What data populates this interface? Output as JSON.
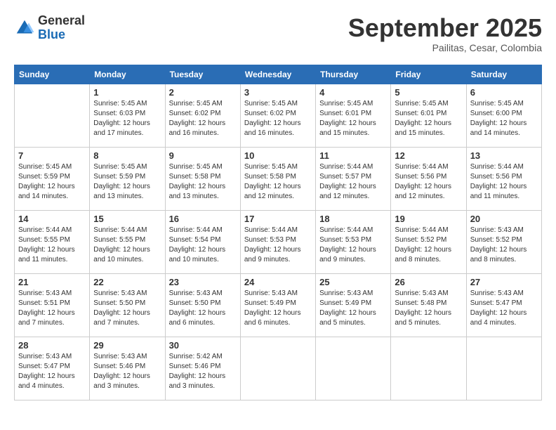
{
  "header": {
    "logo_general": "General",
    "logo_blue": "Blue",
    "month_title": "September 2025",
    "subtitle": "Pailitas, Cesar, Colombia"
  },
  "weekdays": [
    "Sunday",
    "Monday",
    "Tuesday",
    "Wednesday",
    "Thursday",
    "Friday",
    "Saturday"
  ],
  "weeks": [
    [
      {
        "day": "",
        "info": ""
      },
      {
        "day": "1",
        "info": "Sunrise: 5:45 AM\nSunset: 6:03 PM\nDaylight: 12 hours\nand 17 minutes."
      },
      {
        "day": "2",
        "info": "Sunrise: 5:45 AM\nSunset: 6:02 PM\nDaylight: 12 hours\nand 16 minutes."
      },
      {
        "day": "3",
        "info": "Sunrise: 5:45 AM\nSunset: 6:02 PM\nDaylight: 12 hours\nand 16 minutes."
      },
      {
        "day": "4",
        "info": "Sunrise: 5:45 AM\nSunset: 6:01 PM\nDaylight: 12 hours\nand 15 minutes."
      },
      {
        "day": "5",
        "info": "Sunrise: 5:45 AM\nSunset: 6:01 PM\nDaylight: 12 hours\nand 15 minutes."
      },
      {
        "day": "6",
        "info": "Sunrise: 5:45 AM\nSunset: 6:00 PM\nDaylight: 12 hours\nand 14 minutes."
      }
    ],
    [
      {
        "day": "7",
        "info": "Sunrise: 5:45 AM\nSunset: 5:59 PM\nDaylight: 12 hours\nand 14 minutes."
      },
      {
        "day": "8",
        "info": "Sunrise: 5:45 AM\nSunset: 5:59 PM\nDaylight: 12 hours\nand 13 minutes."
      },
      {
        "day": "9",
        "info": "Sunrise: 5:45 AM\nSunset: 5:58 PM\nDaylight: 12 hours\nand 13 minutes."
      },
      {
        "day": "10",
        "info": "Sunrise: 5:45 AM\nSunset: 5:58 PM\nDaylight: 12 hours\nand 12 minutes."
      },
      {
        "day": "11",
        "info": "Sunrise: 5:44 AM\nSunset: 5:57 PM\nDaylight: 12 hours\nand 12 minutes."
      },
      {
        "day": "12",
        "info": "Sunrise: 5:44 AM\nSunset: 5:56 PM\nDaylight: 12 hours\nand 12 minutes."
      },
      {
        "day": "13",
        "info": "Sunrise: 5:44 AM\nSunset: 5:56 PM\nDaylight: 12 hours\nand 11 minutes."
      }
    ],
    [
      {
        "day": "14",
        "info": "Sunrise: 5:44 AM\nSunset: 5:55 PM\nDaylight: 12 hours\nand 11 minutes."
      },
      {
        "day": "15",
        "info": "Sunrise: 5:44 AM\nSunset: 5:55 PM\nDaylight: 12 hours\nand 10 minutes."
      },
      {
        "day": "16",
        "info": "Sunrise: 5:44 AM\nSunset: 5:54 PM\nDaylight: 12 hours\nand 10 minutes."
      },
      {
        "day": "17",
        "info": "Sunrise: 5:44 AM\nSunset: 5:53 PM\nDaylight: 12 hours\nand 9 minutes."
      },
      {
        "day": "18",
        "info": "Sunrise: 5:44 AM\nSunset: 5:53 PM\nDaylight: 12 hours\nand 9 minutes."
      },
      {
        "day": "19",
        "info": "Sunrise: 5:44 AM\nSunset: 5:52 PM\nDaylight: 12 hours\nand 8 minutes."
      },
      {
        "day": "20",
        "info": "Sunrise: 5:43 AM\nSunset: 5:52 PM\nDaylight: 12 hours\nand 8 minutes."
      }
    ],
    [
      {
        "day": "21",
        "info": "Sunrise: 5:43 AM\nSunset: 5:51 PM\nDaylight: 12 hours\nand 7 minutes."
      },
      {
        "day": "22",
        "info": "Sunrise: 5:43 AM\nSunset: 5:50 PM\nDaylight: 12 hours\nand 7 minutes."
      },
      {
        "day": "23",
        "info": "Sunrise: 5:43 AM\nSunset: 5:50 PM\nDaylight: 12 hours\nand 6 minutes."
      },
      {
        "day": "24",
        "info": "Sunrise: 5:43 AM\nSunset: 5:49 PM\nDaylight: 12 hours\nand 6 minutes."
      },
      {
        "day": "25",
        "info": "Sunrise: 5:43 AM\nSunset: 5:49 PM\nDaylight: 12 hours\nand 5 minutes."
      },
      {
        "day": "26",
        "info": "Sunrise: 5:43 AM\nSunset: 5:48 PM\nDaylight: 12 hours\nand 5 minutes."
      },
      {
        "day": "27",
        "info": "Sunrise: 5:43 AM\nSunset: 5:47 PM\nDaylight: 12 hours\nand 4 minutes."
      }
    ],
    [
      {
        "day": "28",
        "info": "Sunrise: 5:43 AM\nSunset: 5:47 PM\nDaylight: 12 hours\nand 4 minutes."
      },
      {
        "day": "29",
        "info": "Sunrise: 5:43 AM\nSunset: 5:46 PM\nDaylight: 12 hours\nand 3 minutes."
      },
      {
        "day": "30",
        "info": "Sunrise: 5:42 AM\nSunset: 5:46 PM\nDaylight: 12 hours\nand 3 minutes."
      },
      {
        "day": "",
        "info": ""
      },
      {
        "day": "",
        "info": ""
      },
      {
        "day": "",
        "info": ""
      },
      {
        "day": "",
        "info": ""
      }
    ]
  ]
}
